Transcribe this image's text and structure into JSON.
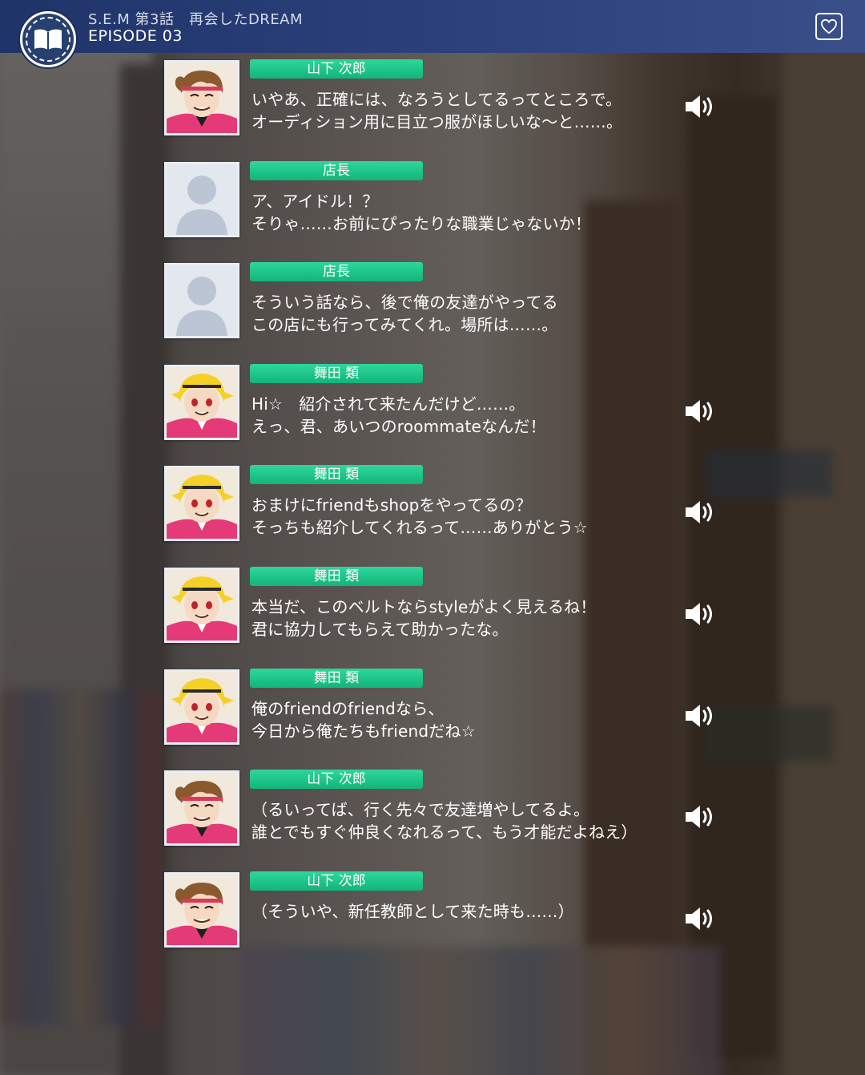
{
  "header": {
    "title": "S.E.M 第3話　再会したDREAM",
    "episode": "EPISODE 03"
  },
  "colors": {
    "header_bg": "#2a3f7a",
    "name_badge": "#1cc488",
    "text": "#ffffff"
  },
  "messages": [
    {
      "speaker": "山下 次郎",
      "avatar": "jiro",
      "has_voice": true,
      "line1": "いやあ、正確には、なろうとしてるってところで。",
      "line2": "オーディション用に目立つ服がほしいな～と……。"
    },
    {
      "speaker": "店長",
      "avatar": "placeholder",
      "has_voice": false,
      "line1": "ア、アイドル！？",
      "line2": "そりゃ……お前にぴったりな職業じゃないか！"
    },
    {
      "speaker": "店長",
      "avatar": "placeholder",
      "has_voice": false,
      "line1": "そういう話なら、後で俺の友達がやってる",
      "line2": "この店にも行ってみてくれ。場所は……。"
    },
    {
      "speaker": "舞田 類",
      "avatar": "rui",
      "has_voice": true,
      "line1": "Hi☆　紹介されて来たんだけど……。",
      "line2": "えっ、君、あいつのroommateなんだ！"
    },
    {
      "speaker": "舞田 類",
      "avatar": "rui",
      "has_voice": true,
      "line1": "おまけにfriendもshopをやってるの？",
      "line2": "そっちも紹介してくれるって……ありがとう☆"
    },
    {
      "speaker": "舞田 類",
      "avatar": "rui",
      "has_voice": true,
      "line1": "本当だ、このベルトならstyleがよく見えるね！",
      "line2": "君に協力してもらえて助かったな。"
    },
    {
      "speaker": "舞田 類",
      "avatar": "rui",
      "has_voice": true,
      "line1": "俺のfriendのfriendなら、",
      "line2": "今日から俺たちもfriendだね☆"
    },
    {
      "speaker": "山下 次郎",
      "avatar": "jiro",
      "has_voice": true,
      "line1": "（るいってば、行く先々で友達増やしてるよ。",
      "line2": "誰とでもすぐ仲良くなれるって、もう才能だよねえ）"
    },
    {
      "speaker": "山下 次郎",
      "avatar": "jiro",
      "has_voice": true,
      "line1": "（そういや、新任教師として来た時も……）",
      "line2": ""
    }
  ]
}
